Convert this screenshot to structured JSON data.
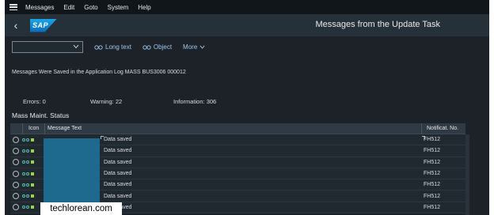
{
  "menubar": {
    "items": [
      {
        "label": "Messages"
      },
      {
        "label": "Edit"
      },
      {
        "label": "Goto"
      },
      {
        "label": "System"
      },
      {
        "label": "Help"
      }
    ]
  },
  "shellbar": {
    "logo_text": "SAP",
    "title": "Messages from the Update Task"
  },
  "toolbar": {
    "select_value": "",
    "long_text_label": "Long text",
    "object_label": "Object",
    "more_label": "More"
  },
  "content": {
    "message": "Messages Were Saved in the Application Log MASS BUS3006 000012",
    "errors_label": "Errors:",
    "errors_value": "0",
    "warning_label": "Warning:",
    "warning_value": "22",
    "information_label": "Information:",
    "information_value": "306",
    "section_title": "Mass Maint. Status"
  },
  "table": {
    "headers": {
      "icon": "Icon",
      "message_text": "Message Text",
      "notification": "Notificat. No."
    },
    "rows": [
      {
        "message": "Data saved",
        "notification": "FH512"
      },
      {
        "message": "Data saved",
        "notification": "FH512"
      },
      {
        "message": "Data saved",
        "notification": "FH512"
      },
      {
        "message": "Data saved",
        "notification": "FH512"
      },
      {
        "message": "Data saved",
        "notification": "FH512"
      },
      {
        "message": "Data saved",
        "notification": "FH512"
      },
      {
        "message": "Data saved",
        "notification": "FH512"
      }
    ]
  },
  "watermark": {
    "text": "techlorean.com"
  }
}
